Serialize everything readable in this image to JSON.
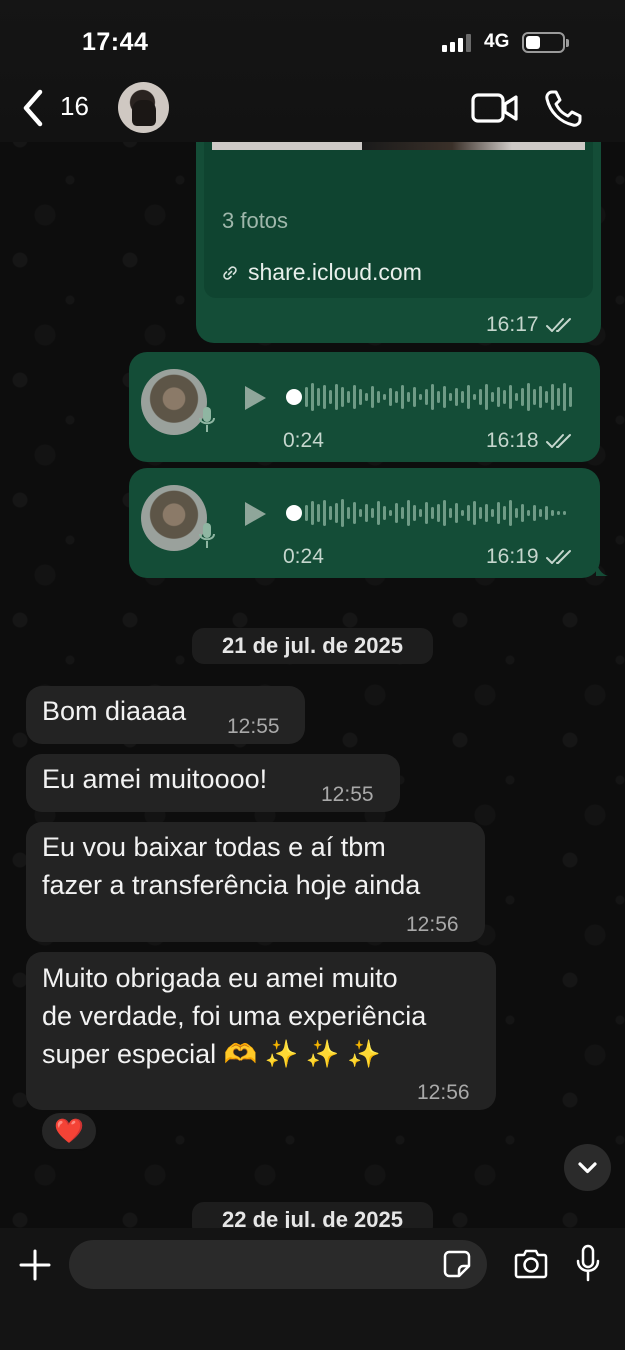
{
  "status_bar": {
    "time": "17:44",
    "network": "4G"
  },
  "header": {
    "back_count": "16"
  },
  "messages": {
    "link_preview": {
      "photos_label": "3 fotos",
      "link": "share.icloud.com",
      "time": "16:17"
    },
    "voice_1": {
      "duration": "0:24",
      "time": "16:18"
    },
    "voice_2": {
      "duration": "0:24",
      "time": "16:19"
    },
    "date_1": "21 de jul. de 2025",
    "msg_1": {
      "text": "Bom diaaaa",
      "time": "12:55"
    },
    "msg_2": {
      "text": "Eu amei muitoooo!",
      "time": "12:55"
    },
    "msg_3": {
      "text": "Eu vou baixar todas e aí tbm\nfazer a transferência hoje ainda",
      "time": "12:56"
    },
    "msg_4": {
      "text": "Muito obrigada eu amei muito\nde verdade, foi uma experiência\nsuper especial 🫶 ✨ ✨ ✨",
      "time": "12:56",
      "reaction": "❤️"
    },
    "date_2": "22 de jul. de 2025"
  },
  "colors": {
    "outgoing_bubble": "#144d37",
    "incoming_bubble": "#232323",
    "read_ticks": "#c5d6cd"
  },
  "icons": [
    "back-chevron-icon",
    "video-call-icon",
    "phone-icon",
    "link-icon",
    "play-icon",
    "mic-icon",
    "double-check-icon",
    "chevron-down-icon",
    "plus-icon",
    "sticker-icon",
    "camera-icon"
  ]
}
